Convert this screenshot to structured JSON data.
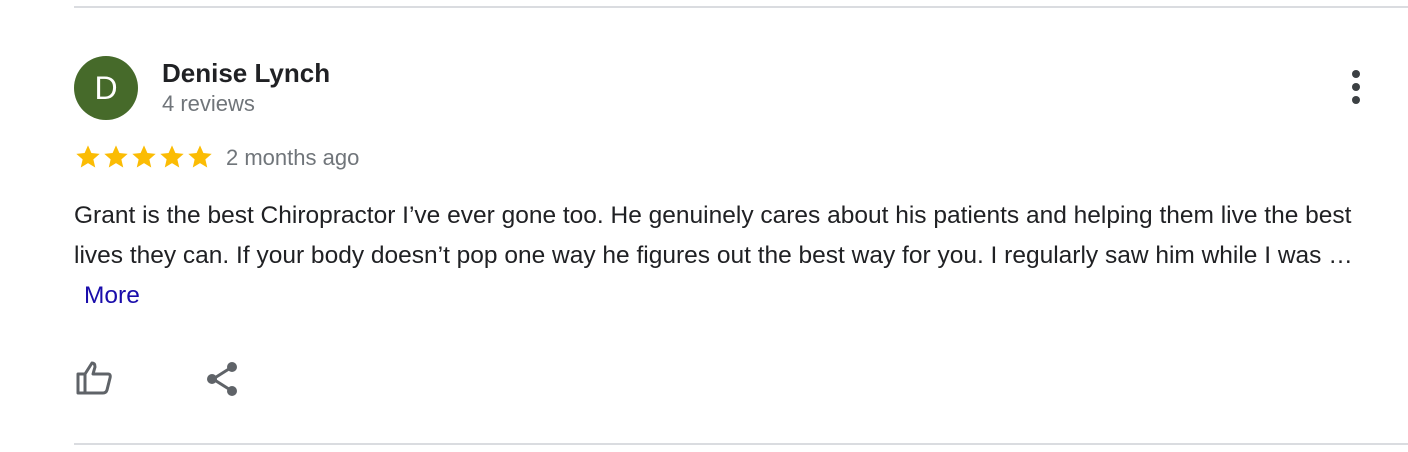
{
  "review": {
    "avatar_initial": "D",
    "reviewer_name": "Denise Lynch",
    "reviewer_count": "4 reviews",
    "rating": 5,
    "rating_max": 5,
    "date": "2 months ago",
    "text": "Grant is the best Chiropractor I’ve ever gone too. He genuinely cares about his patients and helping them live the best lives they can. If your body doesn’t pop one way he figures out the best way for you. I regularly saw him while I was …",
    "more_label": "More"
  },
  "icons": {
    "menu": "more-vert-icon",
    "star": "star-icon",
    "like": "thumb-up-icon",
    "share": "share-icon"
  },
  "colors": {
    "avatar_bg": "#466a2a",
    "star": "#fbbc04",
    "link": "#1a0dab",
    "text": "#202124",
    "secondary_text": "#70757a",
    "divider": "#dadce0"
  }
}
